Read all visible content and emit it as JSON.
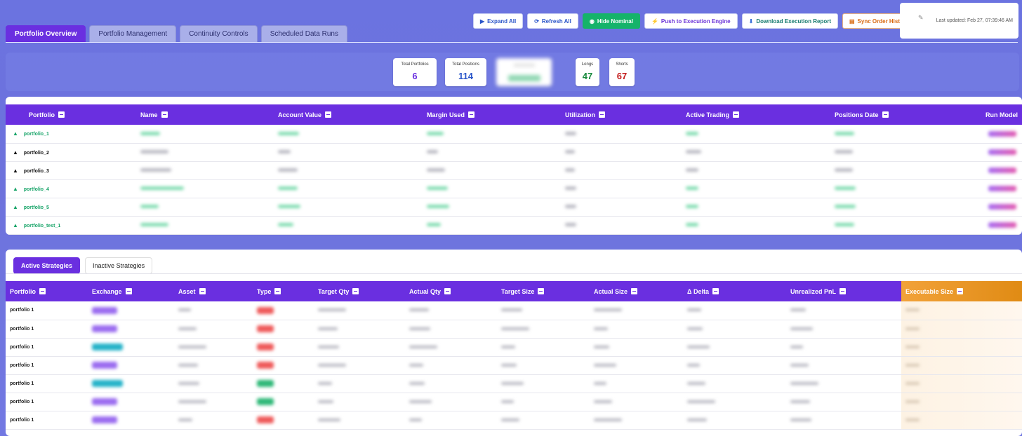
{
  "tabs": [
    "Portfolio Overview",
    "Portfolio Management",
    "Continuity Controls",
    "Scheduled Data Runs"
  ],
  "toolbar": {
    "expand_all": "Expand All",
    "refresh_all": "Refresh All",
    "hide_nominal": "Hide Nominal",
    "push_engine": "Push to Execution Engine",
    "download_report": "Download Execution Report",
    "sync_history": "Sync Order History"
  },
  "last_updated": "Last updated: Feb 27, 07:39:46 AM",
  "stats": {
    "total_portfolios_label": "Total Portfolios",
    "total_portfolios": "6",
    "total_positions_label": "Total Positions",
    "total_positions": "114",
    "longs_label": "Longs",
    "longs": "47",
    "shorts_label": "Shorts",
    "shorts": "67"
  },
  "portfolio_table": {
    "headers": [
      "Portfolio",
      "Name",
      "Account Value",
      "Margin Used",
      "Utilization",
      "Active Trading",
      "Positions Date",
      "Run Model"
    ],
    "rows": [
      {
        "portfolio": "portfolio_1",
        "color": "green"
      },
      {
        "portfolio": "portfolio_2",
        "color": "black"
      },
      {
        "portfolio": "portfolio_3",
        "color": "black"
      },
      {
        "portfolio": "portfolio_4",
        "color": "green"
      },
      {
        "portfolio": "portfolio_5",
        "color": "green"
      },
      {
        "portfolio": "portfolio_test_1",
        "color": "green"
      }
    ]
  },
  "strategy_tabs": [
    "Active Strategies",
    "Inactive Strategies"
  ],
  "strategy_table": {
    "headers": [
      "Portfolio",
      "Exchange",
      "Asset",
      "Type",
      "Target Qty",
      "Actual Qty",
      "Target Size",
      "Actual Size",
      "Δ Delta",
      "Unrealized PnL",
      "Executable Size"
    ],
    "rows": [
      {
        "portfolio": "portfolio 1",
        "exchange_color": "#9b6df0",
        "type_color": "#ef5b5b"
      },
      {
        "portfolio": "portfolio 1",
        "exchange_color": "#9b6df0",
        "type_color": "#ef5b5b"
      },
      {
        "portfolio": "portfolio 1",
        "exchange_color": "#26b3c9",
        "type_color": "#ef5b5b"
      },
      {
        "portfolio": "portfolio 1",
        "exchange_color": "#9b6df0",
        "type_color": "#ef5b5b"
      },
      {
        "portfolio": "portfolio 1",
        "exchange_color": "#26b3c9",
        "type_color": "#2fb878"
      },
      {
        "portfolio": "portfolio 1",
        "exchange_color": "#9b6df0",
        "type_color": "#2fb878"
      },
      {
        "portfolio": "portfolio 1",
        "exchange_color": "#9b6df0",
        "type_color": "#ef5b5b"
      }
    ]
  }
}
